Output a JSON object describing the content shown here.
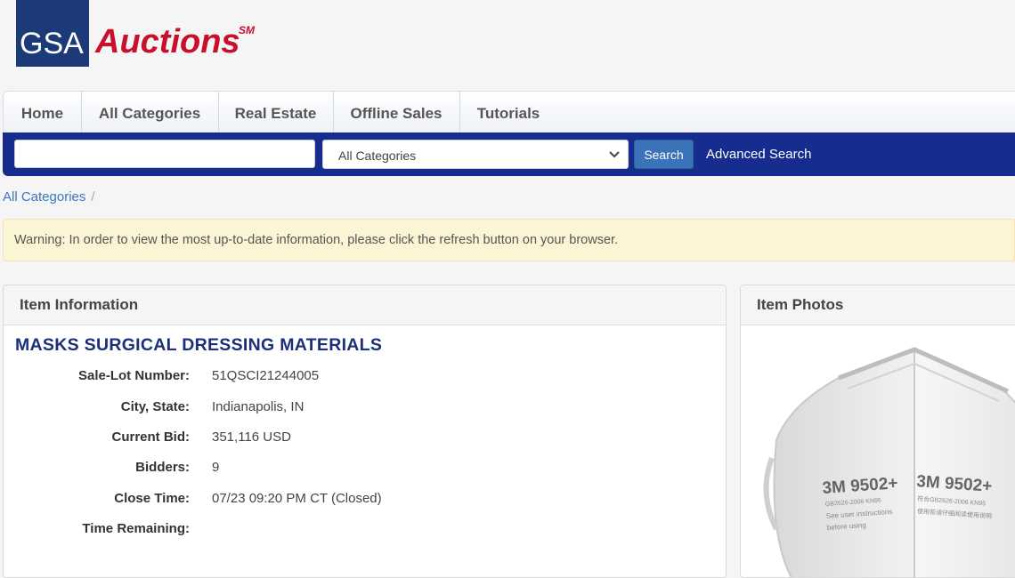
{
  "logo": {
    "gsa": "GSA",
    "auctions": "Auctions",
    "mark": "SM"
  },
  "nav": {
    "tabs": [
      {
        "label": "Home"
      },
      {
        "label": "All Categories"
      },
      {
        "label": "Real Estate"
      },
      {
        "label": "Offline Sales"
      },
      {
        "label": "Tutorials"
      }
    ],
    "search": {
      "value": "",
      "category": "All Categories",
      "button": "Search",
      "advanced": "Advanced Search"
    }
  },
  "breadcrumb": {
    "root": "All Categories",
    "separator": "/"
  },
  "warning": "Warning: In order to view the most up-to-date information, please click the refresh button on your browser.",
  "item_info": {
    "header": "Item Information",
    "title": "MASKS SURGICAL DRESSING MATERIALS",
    "rows": [
      {
        "label": "Sale-Lot Number:",
        "value": "51QSCI21244005"
      },
      {
        "label": "City, State:",
        "value": "Indianapolis, IN"
      },
      {
        "label": "Current Bid:",
        "value": "351,116 USD"
      },
      {
        "label": "Bidders:",
        "value": "9"
      },
      {
        "label": "Close Time:",
        "value": "07/23 09:20 PM CT (Closed)"
      },
      {
        "label": "Time Remaining:",
        "value": ""
      }
    ]
  },
  "item_photos": {
    "header": "Item Photos",
    "mask_text": {
      "left_model": "3M 9502+",
      "left_std": "GB2626-2006 KN95",
      "left_note1": "See user instructions",
      "left_note2": "before using",
      "right_model": "3M 9502+",
      "right_std": "符合GB2626-2006 KN95",
      "right_note": "使用前请仔细阅读使用说明"
    }
  },
  "colors": {
    "brand_blue": "#1d3a78",
    "brand_red": "#c8102e",
    "nav_bar": "#162c8f",
    "title_blue": "#1c2f7a",
    "link": "#3b77c2"
  }
}
